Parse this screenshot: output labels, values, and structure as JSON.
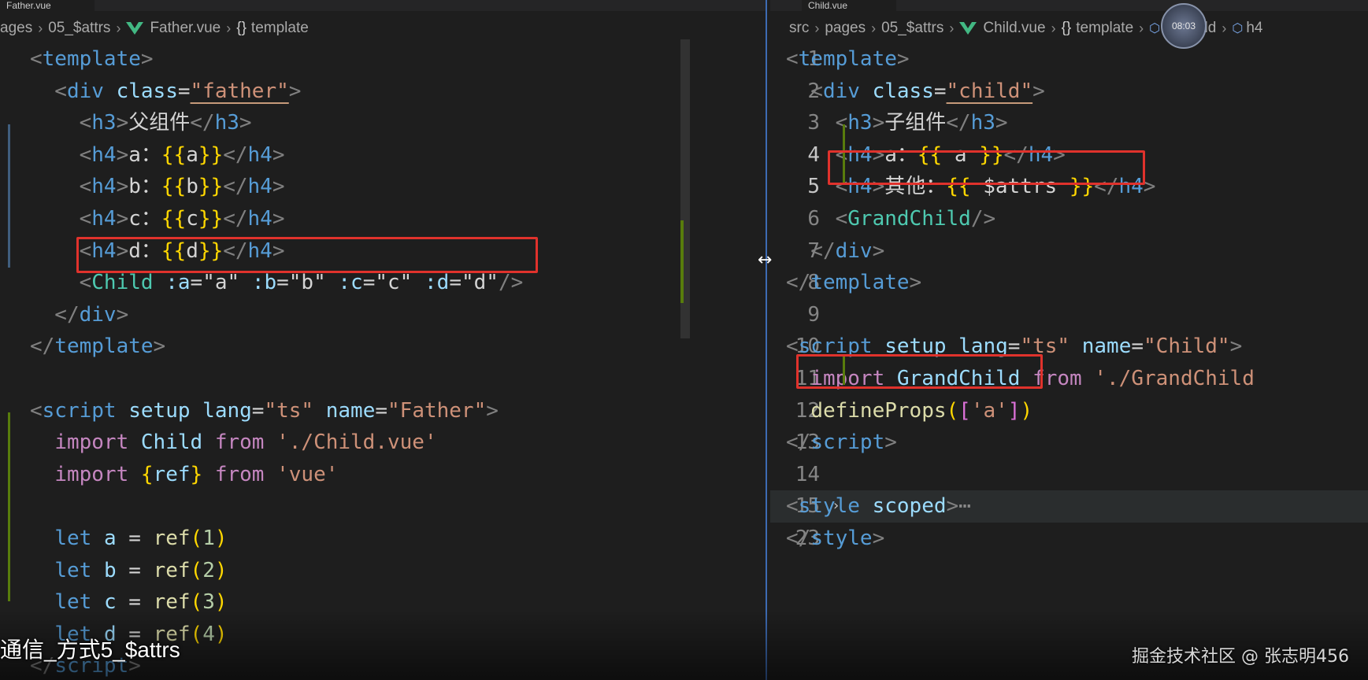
{
  "left_pane": {
    "tab_label": "Father.vue",
    "breadcrumb": {
      "items": [
        "ages",
        "05_$attrs",
        "Father.vue",
        "template"
      ]
    },
    "lines": [
      {
        "segs": [
          [
            "tk-pun",
            "<"
          ],
          [
            "tk-tag",
            "template"
          ],
          [
            "tk-pun",
            ">"
          ]
        ]
      },
      {
        "segs": [
          [
            "tk-pun",
            "  <"
          ],
          [
            "tk-tag",
            "div"
          ],
          [
            "tk-txt",
            " "
          ],
          [
            "tk-attr",
            "class"
          ],
          [
            "tk-txt",
            "="
          ],
          [
            "tk-str squig",
            "\"father\""
          ],
          [
            "tk-pun",
            ">"
          ]
        ]
      },
      {
        "segs": [
          [
            "tk-pun",
            "    <"
          ],
          [
            "tk-tag",
            "h3"
          ],
          [
            "tk-pun",
            ">"
          ],
          [
            "tk-txt",
            "父组件"
          ],
          [
            "tk-pun",
            "</"
          ],
          [
            "tk-tag",
            "h3"
          ],
          [
            "tk-pun",
            ">"
          ]
        ]
      },
      {
        "segs": [
          [
            "tk-pun",
            "    <"
          ],
          [
            "tk-tag",
            "h4"
          ],
          [
            "tk-pun",
            ">"
          ],
          [
            "tk-txt",
            "a："
          ],
          [
            "tk-br",
            "{{"
          ],
          [
            "tk-txt",
            "a"
          ],
          [
            "tk-br",
            "}}"
          ],
          [
            "tk-pun",
            "</"
          ],
          [
            "tk-tag",
            "h4"
          ],
          [
            "tk-pun",
            ">"
          ]
        ]
      },
      {
        "segs": [
          [
            "tk-pun",
            "    <"
          ],
          [
            "tk-tag",
            "h4"
          ],
          [
            "tk-pun",
            ">"
          ],
          [
            "tk-txt",
            "b："
          ],
          [
            "tk-br",
            "{{"
          ],
          [
            "tk-txt",
            "b"
          ],
          [
            "tk-br",
            "}}"
          ],
          [
            "tk-pun",
            "</"
          ],
          [
            "tk-tag",
            "h4"
          ],
          [
            "tk-pun",
            ">"
          ]
        ]
      },
      {
        "segs": [
          [
            "tk-pun",
            "    <"
          ],
          [
            "tk-tag",
            "h4"
          ],
          [
            "tk-pun",
            ">"
          ],
          [
            "tk-txt",
            "c："
          ],
          [
            "tk-br",
            "{{"
          ],
          [
            "tk-txt",
            "c"
          ],
          [
            "tk-br",
            "}}"
          ],
          [
            "tk-pun",
            "</"
          ],
          [
            "tk-tag",
            "h4"
          ],
          [
            "tk-pun",
            ">"
          ]
        ]
      },
      {
        "segs": [
          [
            "tk-pun",
            "    <"
          ],
          [
            "tk-tag",
            "h4"
          ],
          [
            "tk-pun",
            ">"
          ],
          [
            "tk-txt",
            "d："
          ],
          [
            "tk-br",
            "{{"
          ],
          [
            "tk-txt",
            "d"
          ],
          [
            "tk-br",
            "}}"
          ],
          [
            "tk-pun",
            "</"
          ],
          [
            "tk-tag",
            "h4"
          ],
          [
            "tk-pun",
            ">"
          ]
        ]
      },
      {
        "segs": [
          [
            "tk-pun",
            "    <"
          ],
          [
            "tk-comp",
            "Child"
          ],
          [
            "tk-txt",
            " "
          ],
          [
            "tk-attr",
            ":a"
          ],
          [
            "tk-txt",
            "="
          ],
          [
            "tk-txt",
            "\"a\""
          ],
          [
            "tk-txt",
            " "
          ],
          [
            "tk-attr",
            ":b"
          ],
          [
            "tk-txt",
            "="
          ],
          [
            "tk-txt",
            "\"b\""
          ],
          [
            "tk-txt",
            " "
          ],
          [
            "tk-attr",
            ":c"
          ],
          [
            "tk-txt",
            "="
          ],
          [
            "tk-txt",
            "\"c\""
          ],
          [
            "tk-txt",
            " "
          ],
          [
            "tk-attr",
            ":d"
          ],
          [
            "tk-txt",
            "="
          ],
          [
            "tk-txt",
            "\"d\""
          ],
          [
            "tk-pun",
            "/>"
          ]
        ]
      },
      {
        "segs": [
          [
            "tk-pun",
            "  </"
          ],
          [
            "tk-tag",
            "div"
          ],
          [
            "tk-pun",
            ">"
          ]
        ]
      },
      {
        "segs": [
          [
            "tk-pun",
            "</"
          ],
          [
            "tk-tag",
            "template"
          ],
          [
            "tk-pun",
            ">"
          ]
        ]
      },
      {
        "segs": []
      },
      {
        "segs": [
          [
            "tk-pun",
            "<"
          ],
          [
            "tk-tag",
            "script"
          ],
          [
            "tk-txt",
            " "
          ],
          [
            "tk-attr",
            "setup"
          ],
          [
            "tk-txt",
            " "
          ],
          [
            "tk-attr",
            "lang"
          ],
          [
            "tk-txt",
            "="
          ],
          [
            "tk-str",
            "\"ts\""
          ],
          [
            "tk-txt",
            " "
          ],
          [
            "tk-attr",
            "name"
          ],
          [
            "tk-txt",
            "="
          ],
          [
            "tk-str",
            "\"Father\""
          ],
          [
            "tk-pun",
            ">"
          ]
        ]
      },
      {
        "segs": [
          [
            "tk-txt",
            "  "
          ],
          [
            "tk-kw",
            "import"
          ],
          [
            "tk-txt",
            " "
          ],
          [
            "tk-var",
            "Child"
          ],
          [
            "tk-txt",
            " "
          ],
          [
            "tk-kw",
            "from"
          ],
          [
            "tk-txt",
            " "
          ],
          [
            "tk-str",
            "'./Child.vue'"
          ]
        ]
      },
      {
        "segs": [
          [
            "tk-txt",
            "  "
          ],
          [
            "tk-kw",
            "import"
          ],
          [
            "tk-txt",
            " "
          ],
          [
            "tk-br",
            "{"
          ],
          [
            "tk-var",
            "ref"
          ],
          [
            "tk-br",
            "}"
          ],
          [
            "tk-txt",
            " "
          ],
          [
            "tk-kw",
            "from"
          ],
          [
            "tk-txt",
            " "
          ],
          [
            "tk-str",
            "'vue'"
          ]
        ]
      },
      {
        "segs": []
      },
      {
        "segs": [
          [
            "tk-txt",
            "  "
          ],
          [
            "tk-decl",
            "let"
          ],
          [
            "tk-txt",
            " "
          ],
          [
            "tk-var",
            "a"
          ],
          [
            "tk-txt",
            " = "
          ],
          [
            "tk-fn",
            "ref"
          ],
          [
            "tk-br",
            "("
          ],
          [
            "tk-num",
            "1"
          ],
          [
            "tk-br",
            ")"
          ]
        ]
      },
      {
        "segs": [
          [
            "tk-txt",
            "  "
          ],
          [
            "tk-decl",
            "let"
          ],
          [
            "tk-txt",
            " "
          ],
          [
            "tk-var",
            "b"
          ],
          [
            "tk-txt",
            " = "
          ],
          [
            "tk-fn",
            "ref"
          ],
          [
            "tk-br",
            "("
          ],
          [
            "tk-num",
            "2"
          ],
          [
            "tk-br",
            ")"
          ]
        ]
      },
      {
        "segs": [
          [
            "tk-txt",
            "  "
          ],
          [
            "tk-decl",
            "let"
          ],
          [
            "tk-txt",
            " "
          ],
          [
            "tk-var",
            "c"
          ],
          [
            "tk-txt",
            " = "
          ],
          [
            "tk-fn",
            "ref"
          ],
          [
            "tk-br",
            "("
          ],
          [
            "tk-num",
            "3"
          ],
          [
            "tk-br",
            ")"
          ]
        ]
      },
      {
        "segs": [
          [
            "tk-txt",
            "  "
          ],
          [
            "tk-decl",
            "let"
          ],
          [
            "tk-txt",
            " "
          ],
          [
            "tk-var",
            "d"
          ],
          [
            "tk-txt",
            " = "
          ],
          [
            "tk-fn",
            "ref"
          ],
          [
            "tk-br",
            "("
          ],
          [
            "tk-num",
            "4"
          ],
          [
            "tk-br",
            ")"
          ]
        ]
      },
      {
        "segs": [
          [
            "tk-pun",
            "</"
          ],
          [
            "tk-tag",
            "script"
          ],
          [
            "tk-pun",
            ">"
          ]
        ]
      }
    ]
  },
  "right_pane": {
    "tab_label": "Child.vue",
    "breadcrumb": {
      "items": [
        "src",
        "pages",
        "05_$attrs",
        "Child.vue",
        "template",
        "div.child",
        "h4"
      ]
    },
    "lines": [
      {
        "num": "1",
        "segs": [
          [
            "tk-pun",
            "<"
          ],
          [
            "tk-tag",
            "template"
          ],
          [
            "tk-pun",
            ">"
          ]
        ]
      },
      {
        "num": "2",
        "segs": [
          [
            "tk-pun",
            "  <"
          ],
          [
            "tk-tag",
            "div"
          ],
          [
            "tk-txt",
            " "
          ],
          [
            "tk-attr",
            "class"
          ],
          [
            "tk-txt",
            "="
          ],
          [
            "tk-str squig",
            "\"child\""
          ],
          [
            "tk-pun",
            ">"
          ]
        ]
      },
      {
        "num": "3",
        "segs": [
          [
            "tk-pun",
            "    <"
          ],
          [
            "tk-tag",
            "h3"
          ],
          [
            "tk-pun",
            ">"
          ],
          [
            "tk-txt",
            "子组件"
          ],
          [
            "tk-pun",
            "</"
          ],
          [
            "tk-tag",
            "h3"
          ],
          [
            "tk-pun",
            ">"
          ]
        ]
      },
      {
        "num": "4",
        "segs": [
          [
            "tk-pun",
            "    <"
          ],
          [
            "tk-tag",
            "h4"
          ],
          [
            "tk-pun",
            ">"
          ],
          [
            "tk-txt",
            "a："
          ],
          [
            "tk-br",
            "{{"
          ],
          [
            "tk-txt",
            " a "
          ],
          [
            "tk-br",
            "}}"
          ],
          [
            "tk-pun",
            "</"
          ],
          [
            "tk-tag",
            "h4"
          ],
          [
            "tk-pun",
            ">"
          ]
        ]
      },
      {
        "num": "5",
        "segs": [
          [
            "tk-pun",
            "    <"
          ],
          [
            "tk-tag",
            "h4"
          ],
          [
            "tk-pun",
            ">"
          ],
          [
            "tk-txt",
            "其他："
          ],
          [
            "tk-br",
            "{{"
          ],
          [
            "tk-txt",
            " $attrs "
          ],
          [
            "tk-br",
            "}}"
          ],
          [
            "tk-pun",
            "</"
          ],
          [
            "tk-tag",
            "h4"
          ],
          [
            "tk-pun",
            ">"
          ]
        ]
      },
      {
        "num": "6",
        "segs": [
          [
            "tk-pun",
            "    <"
          ],
          [
            "tk-comp",
            "GrandChild"
          ],
          [
            "tk-pun",
            "/>"
          ]
        ]
      },
      {
        "num": "7",
        "segs": [
          [
            "tk-pun",
            "  </"
          ],
          [
            "tk-tag",
            "div"
          ],
          [
            "tk-pun",
            ">"
          ]
        ]
      },
      {
        "num": "8",
        "segs": [
          [
            "tk-pun",
            "</"
          ],
          [
            "tk-tag",
            "template"
          ],
          [
            "tk-pun",
            ">"
          ]
        ]
      },
      {
        "num": "9",
        "segs": []
      },
      {
        "num": "10",
        "segs": [
          [
            "tk-pun",
            "<"
          ],
          [
            "tk-tag",
            "script"
          ],
          [
            "tk-txt",
            " "
          ],
          [
            "tk-attr",
            "setup"
          ],
          [
            "tk-txt",
            " "
          ],
          [
            "tk-attr",
            "lang"
          ],
          [
            "tk-txt",
            "="
          ],
          [
            "tk-str",
            "\"ts\""
          ],
          [
            "tk-txt",
            " "
          ],
          [
            "tk-attr",
            "name"
          ],
          [
            "tk-txt",
            "="
          ],
          [
            "tk-str",
            "\"Child\""
          ],
          [
            "tk-pun",
            ">"
          ]
        ]
      },
      {
        "num": "11",
        "segs": [
          [
            "tk-txt",
            "  "
          ],
          [
            "tk-kw",
            "import"
          ],
          [
            "tk-txt",
            " "
          ],
          [
            "tk-var",
            "GrandChild"
          ],
          [
            "tk-txt",
            " "
          ],
          [
            "tk-kw",
            "from"
          ],
          [
            "tk-txt",
            " "
          ],
          [
            "tk-str",
            "'./GrandChild"
          ]
        ]
      },
      {
        "num": "12",
        "segs": [
          [
            "tk-txt",
            "  "
          ],
          [
            "tk-fn",
            "defineProps"
          ],
          [
            "tk-br",
            "("
          ],
          [
            "tk-br2",
            "["
          ],
          [
            "tk-str",
            "'a'"
          ],
          [
            "tk-br2",
            "]"
          ],
          [
            "tk-br",
            ")"
          ]
        ]
      },
      {
        "num": "13",
        "segs": [
          [
            "tk-pun",
            "</"
          ],
          [
            "tk-tag",
            "script"
          ],
          [
            "tk-pun",
            ">"
          ]
        ]
      },
      {
        "num": "14",
        "segs": []
      },
      {
        "num": "15",
        "segs": [
          [
            "tk-pun",
            "<"
          ],
          [
            "tk-tag",
            "style"
          ],
          [
            "tk-txt",
            " "
          ],
          [
            "tk-attr",
            "scoped"
          ],
          [
            "tk-pun",
            ">"
          ],
          [
            "ellipsis",
            "⋯"
          ]
        ]
      },
      {
        "num": "23",
        "segs": [
          [
            "tk-pun",
            "</"
          ],
          [
            "tk-tag",
            "style"
          ],
          [
            "tk-pun",
            ">"
          ]
        ]
      }
    ]
  },
  "overlay": {
    "subtitle": "通信_方式5_$attrs",
    "watermark": "掘金技术社区 @ 张志明456",
    "timer_badge": "08:03"
  },
  "icons": {
    "breadcrumb_separator": "chevron-right-icon",
    "vue_file": "vue-logo-icon",
    "template_node": "braces-icon",
    "element_node": "cube-icon",
    "fold_toggle": "chevron-right-icon",
    "resize_cursor": "resize-horizontal-icon"
  },
  "colors": {
    "editor_background": "#1e1e1e",
    "highlight_box": "#e0322c",
    "split_divider": "#3d6bb3",
    "tag": "#569cd6",
    "component": "#4ec9b0",
    "string": "#ce9178",
    "keyword": "#c586c0",
    "bracket": "#ffd700"
  }
}
